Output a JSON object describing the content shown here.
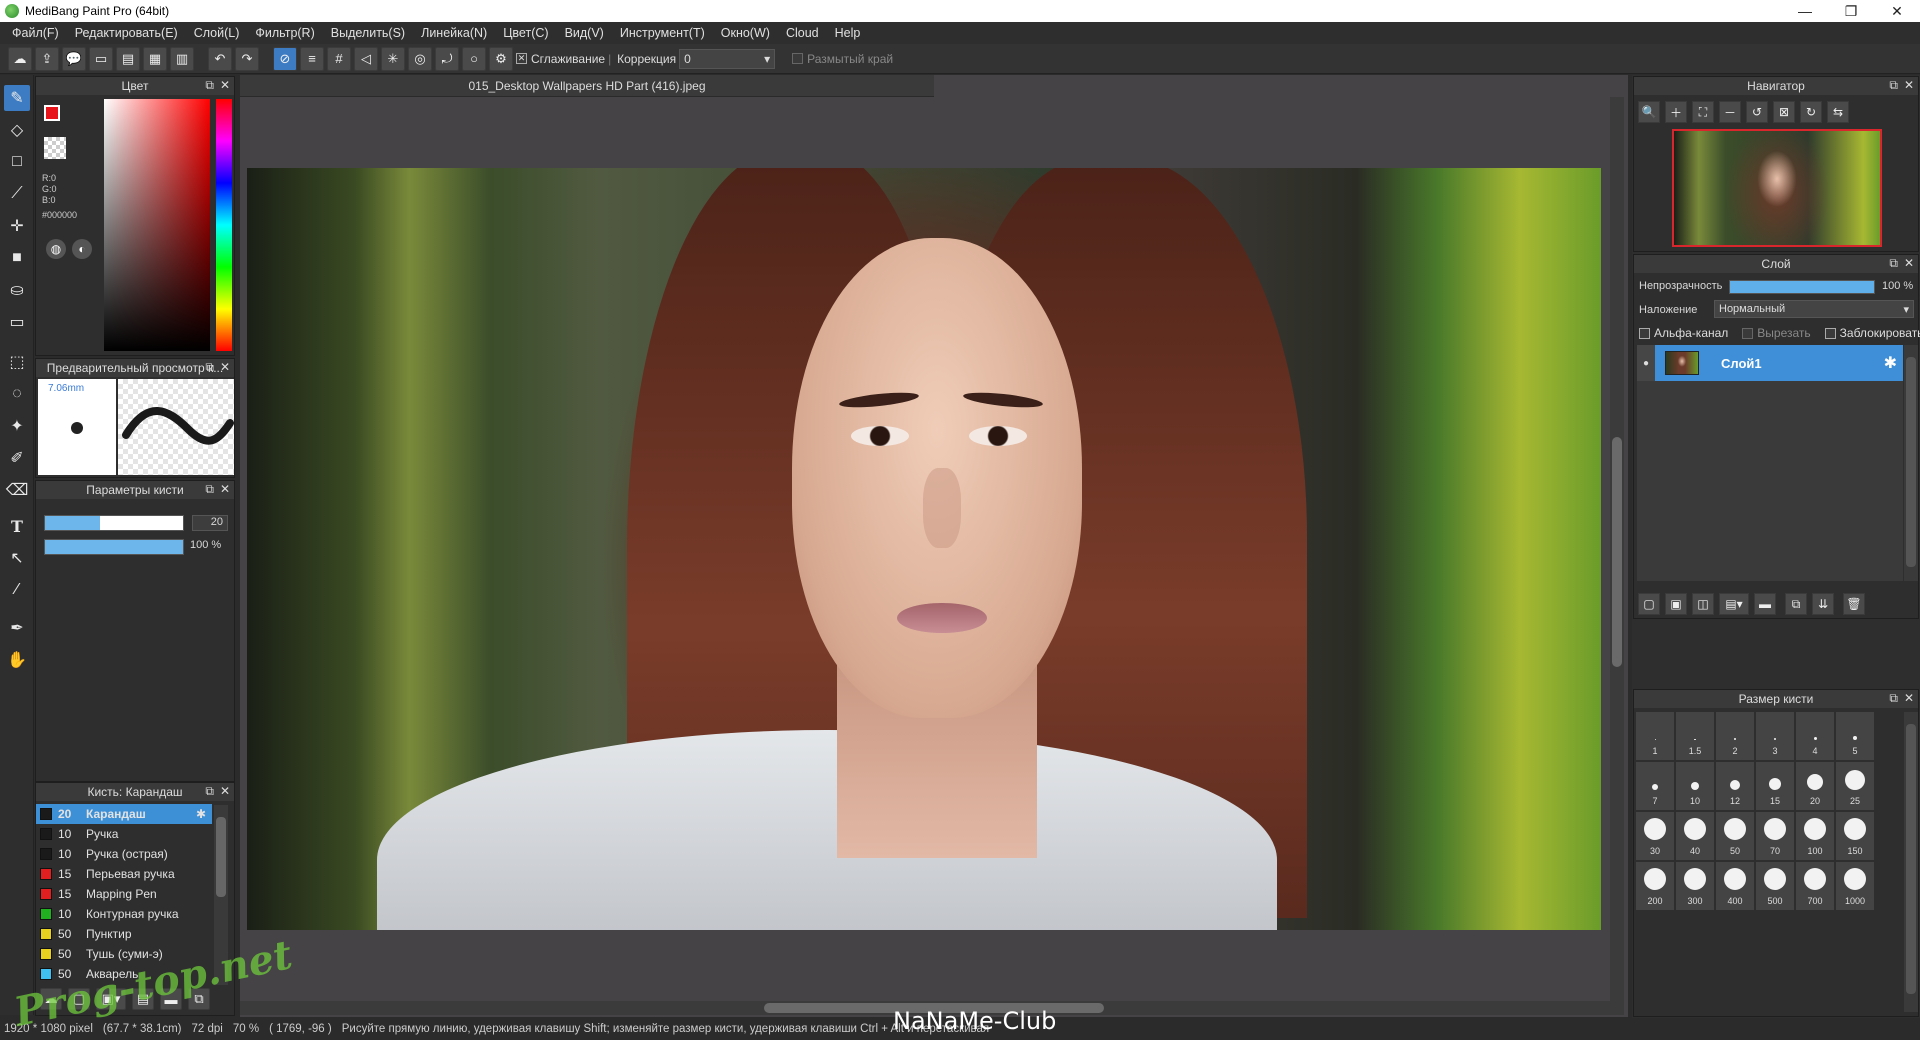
{
  "window": {
    "title": "MediBang Paint Pro (64bit)",
    "min": "—",
    "max": "❐",
    "close": "✕"
  },
  "menu": [
    "Файл(F)",
    "Редактировать(E)",
    "Слой(L)",
    "Фильтр(R)",
    "Выделить(S)",
    "Линейка(N)",
    "Цвет(C)",
    "Вид(V)",
    "Инструмент(T)",
    "Окно(W)",
    "Cloud",
    "Help"
  ],
  "options": {
    "smoothing_label": "Сглаживание",
    "correction_label": "Коррекция",
    "correction_value": "0",
    "blur_edge_label": "Размытый край"
  },
  "document": {
    "tab": "015_Desktop Wallpapers  HD Part (416).jpeg"
  },
  "color_panel": {
    "title": "Цвет",
    "r": "R:0",
    "g": "G:0",
    "b": "B:0",
    "hex": "#000000",
    "fg_color": "#e8141c",
    "bg_color": "#ffffff"
  },
  "preview_panel": {
    "title": "Предварительный просмотр к...",
    "size": "7.06mm"
  },
  "brush_params": {
    "title": "Параметры кисти",
    "size_value": "20",
    "opacity_value": "100 %",
    "size_fill": 0.4,
    "opacity_fill": 1.0
  },
  "brush_list": {
    "title": "Кисть: Карандаш",
    "items": [
      {
        "size": "20",
        "name": "Карандаш",
        "color": "#1a1a1a",
        "selected": true
      },
      {
        "size": "10",
        "name": "Ручка",
        "color": "#1a1a1a"
      },
      {
        "size": "10",
        "name": "Ручка (острая)",
        "color": "#1a1a1a"
      },
      {
        "size": "15",
        "name": "Перьевая ручка",
        "color": "#e02020"
      },
      {
        "size": "15",
        "name": "Mapping Pen",
        "color": "#e02020"
      },
      {
        "size": "10",
        "name": "Контурная ручка",
        "color": "#20b020"
      },
      {
        "size": "50",
        "name": "Пунктир",
        "color": "#e8d020"
      },
      {
        "size": "50",
        "name": "Тушь (суми-э)",
        "color": "#e8d020"
      },
      {
        "size": "50",
        "name": "Акварель",
        "color": "#40c0f0"
      }
    ]
  },
  "navigator": {
    "title": "Навигатор"
  },
  "layer_panel": {
    "title": "Слой",
    "opacity_label": "Непрозрачность",
    "opacity_value": "100 %",
    "opacity_fill": 1.0,
    "blend_label": "Наложение",
    "blend_value": "Нормальный",
    "alpha_label": "Альфа-канал",
    "clip_label": "Вырезать",
    "lock_label": "Заблокировать",
    "layer_name": "Слой1"
  },
  "brush_size_panel": {
    "title": "Размер кисти",
    "sizes": [
      "1",
      "1.5",
      "2",
      "3",
      "4",
      "5",
      "7",
      "10",
      "12",
      "15",
      "20",
      "25",
      "30",
      "40",
      "50",
      "70",
      "100",
      "150",
      "200",
      "300",
      "400",
      "500",
      "700",
      "1000"
    ]
  },
  "status": {
    "dimensions": "1920 * 1080 pixel",
    "physical": "(67.7 * 38.1cm)",
    "dpi": "72 dpi",
    "zoom": "70 %",
    "coords": "( 1769, -96 )",
    "hint": "Рисуйте прямую линию, удерживая клавишу Shift; изменяйте размер кисти, удерживая клавиши Ctrl + Alt и перетаскивая"
  },
  "watermarks": {
    "left": "Prog-top.net",
    "center": "NaNaMe-Club"
  }
}
